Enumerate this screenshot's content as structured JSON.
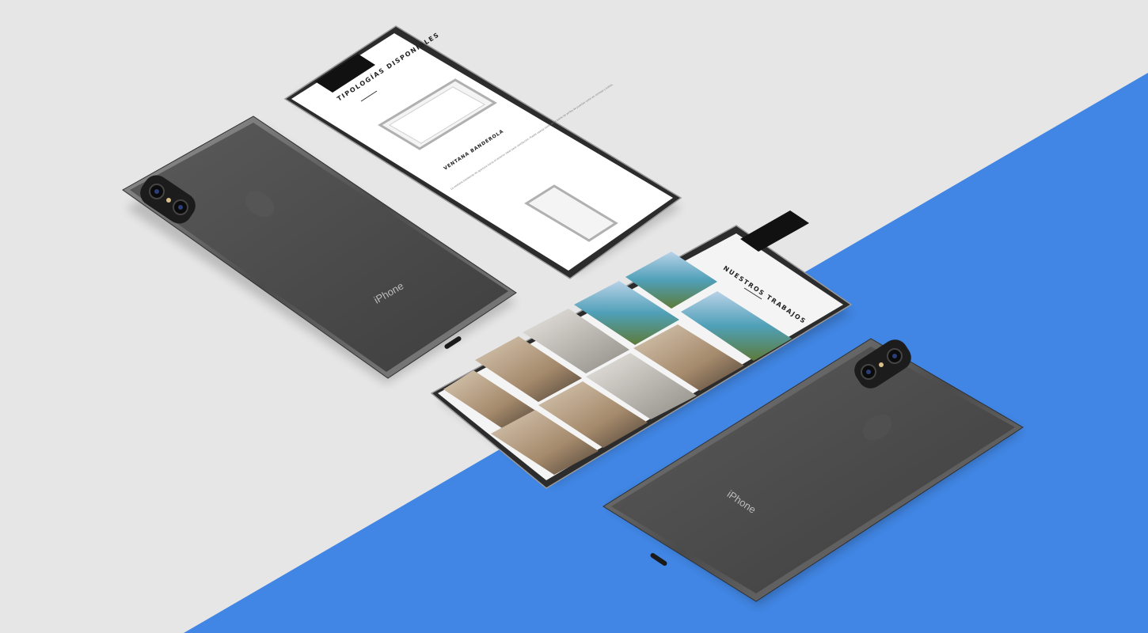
{
  "background": {
    "light_color": "#e6e6e6",
    "accent_color": "#4186e4"
  },
  "phones": {
    "back_left": {
      "brand_label": "iPhone",
      "icon": "apple-logo-icon",
      "camera_icon": "dual-camera-icon"
    },
    "back_right": {
      "brand_label": "iPhone",
      "icon": "apple-logo-icon",
      "camera_icon": "dual-camera-icon"
    },
    "front_top": {
      "section_title": "TIPOLOGÍAS DISPONIBLES",
      "product_title": "VENTANA BANDEROLA",
      "product_description": "La ventana banderola de apertura hacia el exterior ideal para ventilación. Puede usarse tanto en la parte de arriba de puertas como en cocinas y baños.",
      "images": [
        "window-banderola-image",
        "window-banderola-image-2"
      ]
    },
    "front_bottom": {
      "section_title": "NUESTROS TRABAJOS",
      "gallery": [
        "pool-enclosure-photo",
        "pool-enclosure-photo",
        "pool-enclosure-photo",
        "house-exterior-photo",
        "house-interior-photo",
        "house-exterior-photo",
        "house-exterior-photo",
        "house-interior-photo",
        "house-exterior-photo",
        "house-exterior-photo",
        "house-exterior-photo",
        "house-interior-photo"
      ]
    }
  }
}
